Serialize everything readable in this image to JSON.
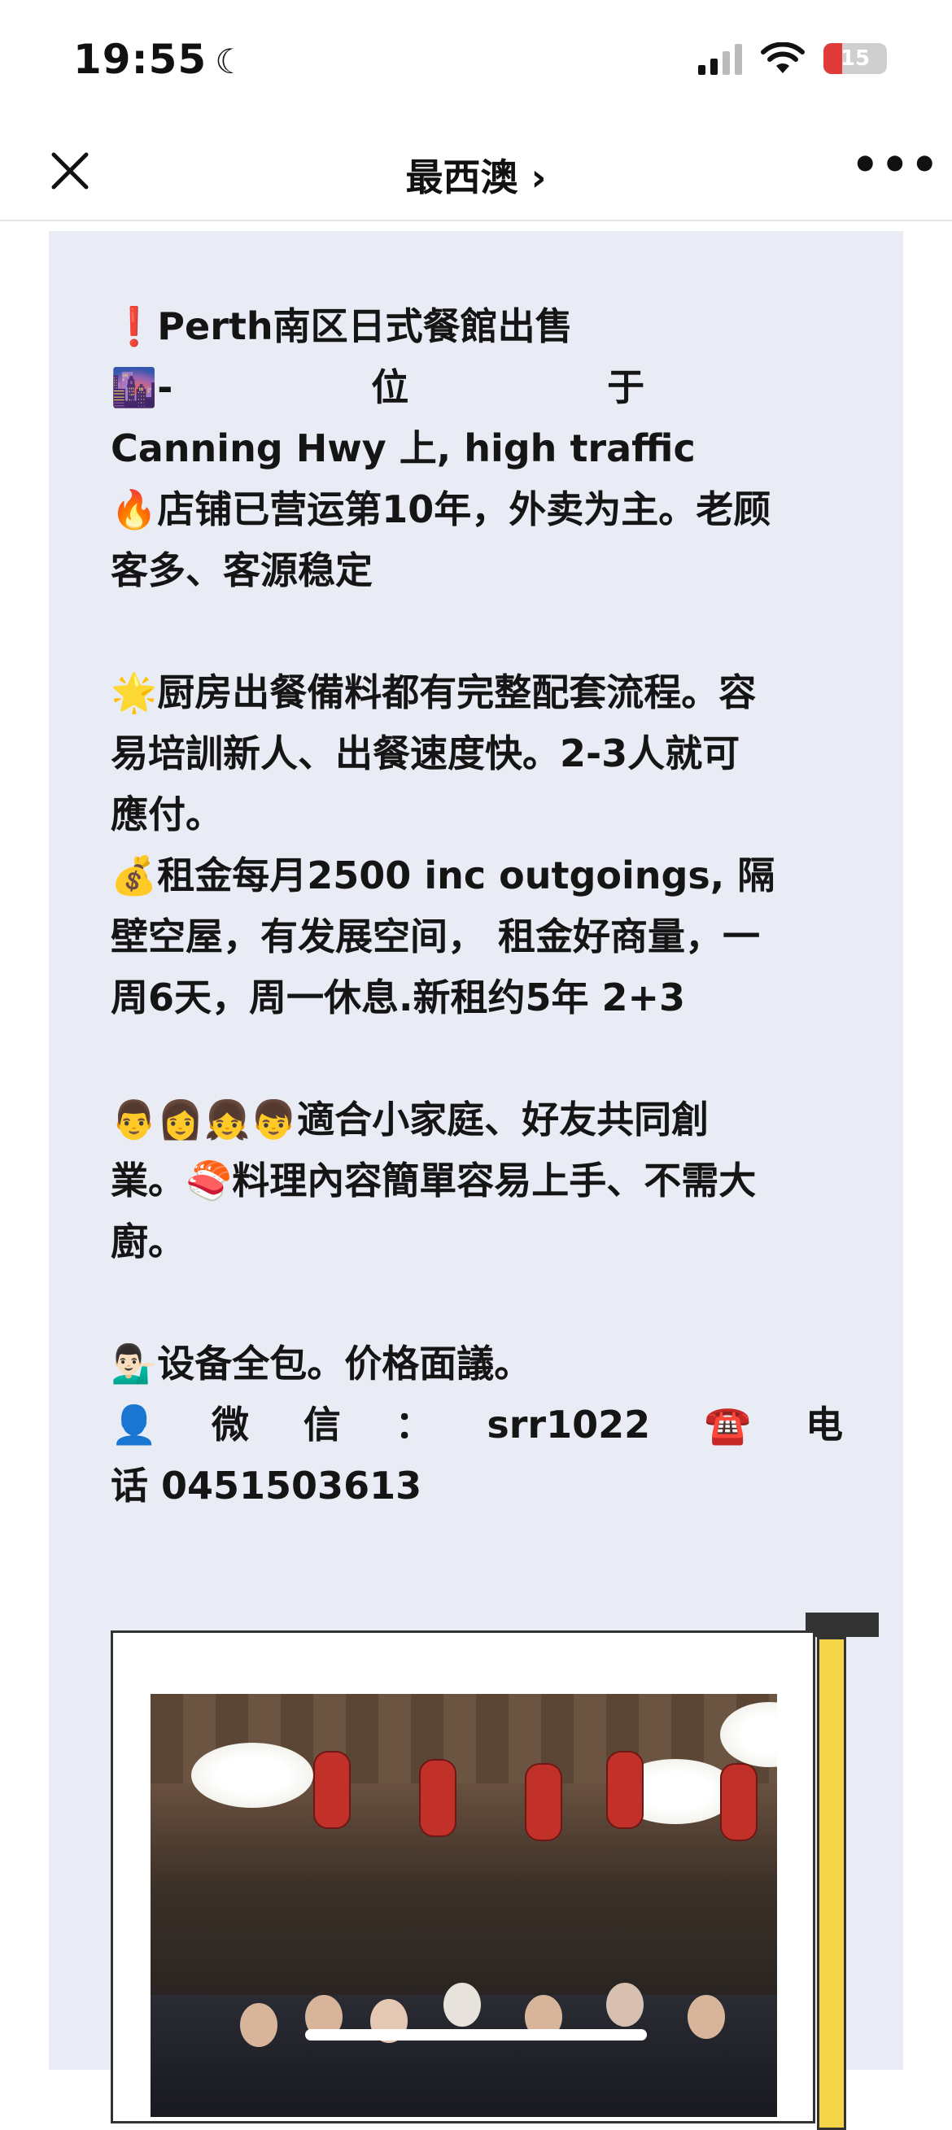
{
  "status_bar": {
    "time": "19:55",
    "battery_level": "15"
  },
  "nav": {
    "title": "最西澳 ›"
  },
  "article": {
    "lines": {
      "l1": "❗️Perth南区日式餐館出售",
      "l2_emoji": "🌆-",
      "l2_w1": "位",
      "l2_w2": "于",
      "l3": "Canning Hwy 上, high traffic",
      "l4": "🔥店铺已营运第10年，外卖为主。老顾",
      "l5": "客多、客源稳定",
      "l6": "🌟厨房出餐備料都有完整配套流程。容",
      "l7": "易培訓新人、出餐速度快。2-3人就可",
      "l8": "應付。",
      "l9": "💰租金每月2500 inc outgoings, 隔",
      "l10": "壁空屋，有发展空间， 租金好商量，一",
      "l11": "周6天，周一休息.新租约5年 2+3",
      "l12": "👨👩👧👦適合小家庭、好友共同創",
      "l13": "業。🍣料理內容簡單容易上手、不需大",
      "l14": "廚。",
      "l15": "💁🏻‍♂️设备全包。价格面議。",
      "l16_a": "👤",
      "l16_b": "微",
      "l16_c": "信",
      "l16_d": "：",
      "l16_e": "srr1022",
      "l16_f": "☎️",
      "l16_g": "电",
      "l17": "话 0451503613"
    }
  }
}
